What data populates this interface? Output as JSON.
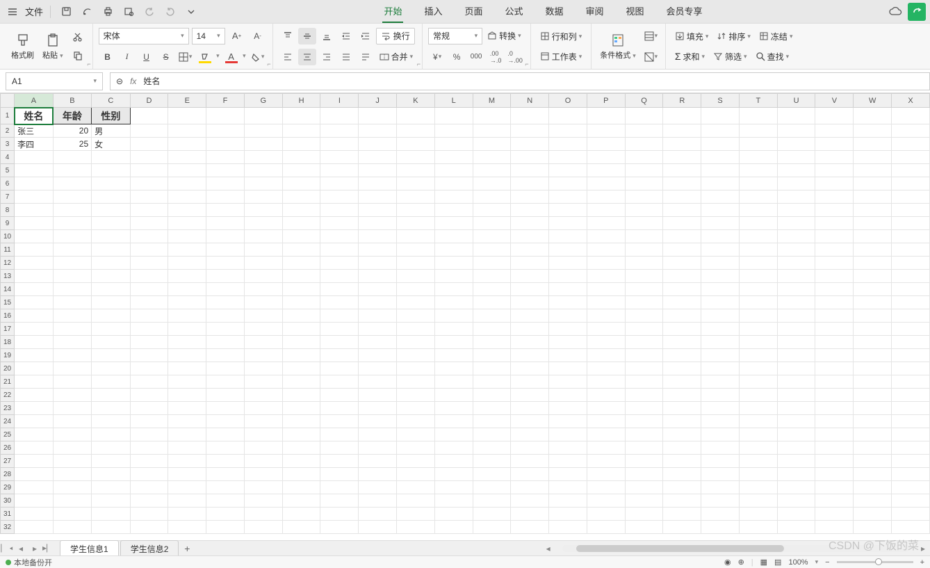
{
  "menubar": {
    "file": "文件"
  },
  "menu_tabs": [
    "开始",
    "插入",
    "页面",
    "公式",
    "数据",
    "审阅",
    "视图",
    "会员专享"
  ],
  "active_menu_tab": 0,
  "ribbon": {
    "format_painter": "格式刷",
    "paste": "粘贴",
    "font_name": "宋体",
    "font_size": "14",
    "wrap": "换行",
    "number_format": "常规",
    "convert": "转换",
    "rows_cols": "行和列",
    "sheet": "工作表",
    "cond_format": "条件格式",
    "fill": "填充",
    "sort": "排序",
    "freeze": "冻结",
    "sum": "求和",
    "filter": "筛选",
    "find": "查找",
    "merge": "合并"
  },
  "namebox": "A1",
  "formula": "姓名",
  "columns": [
    "A",
    "B",
    "C",
    "D",
    "E",
    "F",
    "G",
    "H",
    "I",
    "J",
    "K",
    "L",
    "M",
    "N",
    "O",
    "P",
    "Q",
    "R",
    "S",
    "T",
    "U",
    "V",
    "W",
    "X"
  ],
  "data": {
    "headers": [
      "姓名",
      "年龄",
      "性别"
    ],
    "rows": [
      {
        "name": "张三",
        "age": "20",
        "gender": "男"
      },
      {
        "name": "李四",
        "age": "25",
        "gender": "女"
      }
    ]
  },
  "sheet_tabs": [
    "学生信息1",
    "学生信息2"
  ],
  "active_sheet": 0,
  "status": {
    "backup": "本地备份开",
    "zoom": "100%"
  },
  "watermark": "CSDN @下饭的菜"
}
